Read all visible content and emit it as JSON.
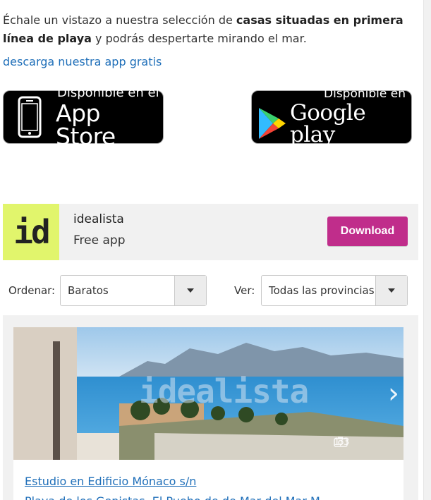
{
  "intro": {
    "text_prefix": "Échale un vistazo a nuestra selección de ",
    "text_bold": "casas situadas en primera línea de playa",
    "text_suffix": " y podrás despertarte mirando el mar.",
    "link": "descarga nuestra app gratis"
  },
  "badges": {
    "apple": {
      "small": "Disponible en el",
      "big": "App Store"
    },
    "google": {
      "small": "Disponible en",
      "big": "Google play"
    }
  },
  "app_banner": {
    "logo": "id",
    "name": "idealista",
    "subtitle": "Free app",
    "button": "Download",
    "button_color": "#c02d8b",
    "logo_color": "#e1f56c"
  },
  "filters": {
    "order_label": "Ordenar:",
    "order_value": "Baratos",
    "view_label": "Ver:",
    "view_value": "Todas las provincias"
  },
  "listing": {
    "watermark": "idealista",
    "photo_counter": "1/3",
    "title": "Estudio en Edificio Mónaco s/n",
    "subtitle": "Playa de los Genistas, El Puebo de de Mar del Mar M"
  },
  "colors": {
    "link": "#1f6fb9",
    "panel_bg": "#f1f1f1"
  }
}
